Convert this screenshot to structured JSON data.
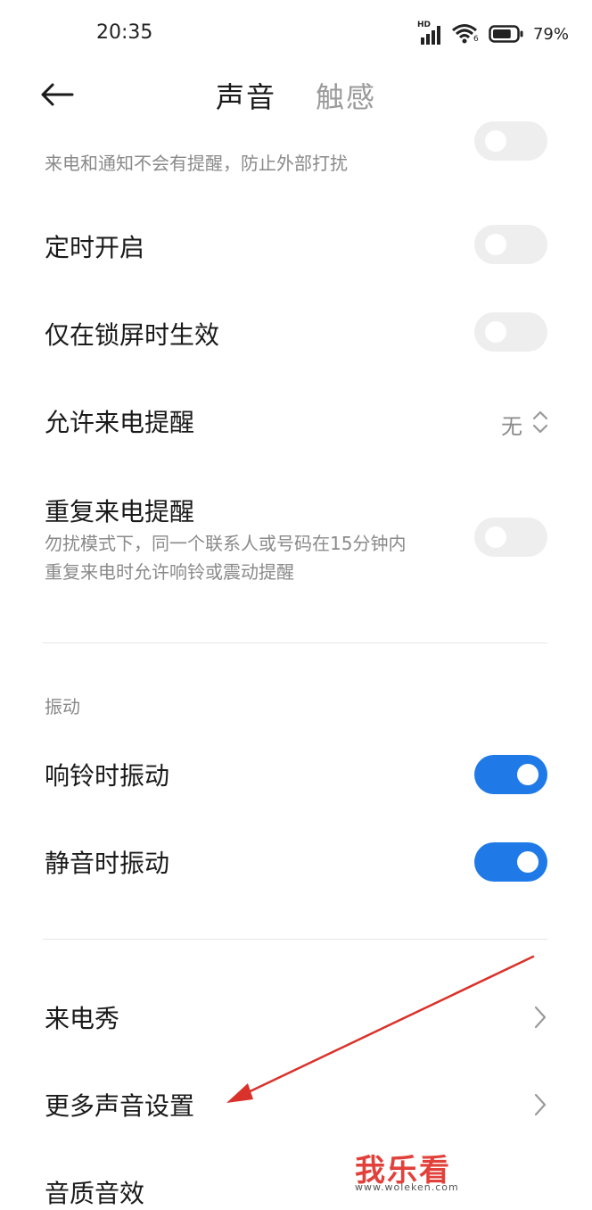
{
  "status": {
    "time": "20:35",
    "network": "HD",
    "wifi_badge": "6",
    "battery_level": 79,
    "battery_text": "79%"
  },
  "header": {
    "tabs": [
      {
        "label": "声音",
        "active": true
      },
      {
        "label": "触感",
        "active": false
      }
    ]
  },
  "settings": {
    "dnd": {
      "subtitle": "来电和通知不会有提醒，防止外部打扰",
      "enabled": false
    },
    "scheduled": {
      "title": "定时开启",
      "enabled": false
    },
    "lockscreen_only": {
      "title": "仅在锁屏时生效",
      "enabled": false
    },
    "allow_calls": {
      "title": "允许来电提醒",
      "value": "无"
    },
    "repeat_calls": {
      "title": "重复来电提醒",
      "subtitle_line1": "勿扰模式下，同一个联系人或号码在15分钟内",
      "subtitle_line2": "重复来电时允许响铃或震动提醒",
      "enabled": false
    }
  },
  "vibration": {
    "section_label": "振动",
    "ring_vibrate": {
      "title": "响铃时振动",
      "enabled": true
    },
    "silent_vibrate": {
      "title": "静音时振动",
      "enabled": true
    }
  },
  "more": {
    "caller_show": {
      "title": "来电秀"
    },
    "more_sound": {
      "title": "更多声音设置"
    },
    "sound_quality": {
      "title": "音质音效"
    }
  },
  "watermark": {
    "logo": "我乐看",
    "url": "www.woleken.com"
  },
  "colors": {
    "accent": "#1f7ae8",
    "toggle_off": "#eeeeee",
    "annotation_arrow": "#d9322b"
  }
}
